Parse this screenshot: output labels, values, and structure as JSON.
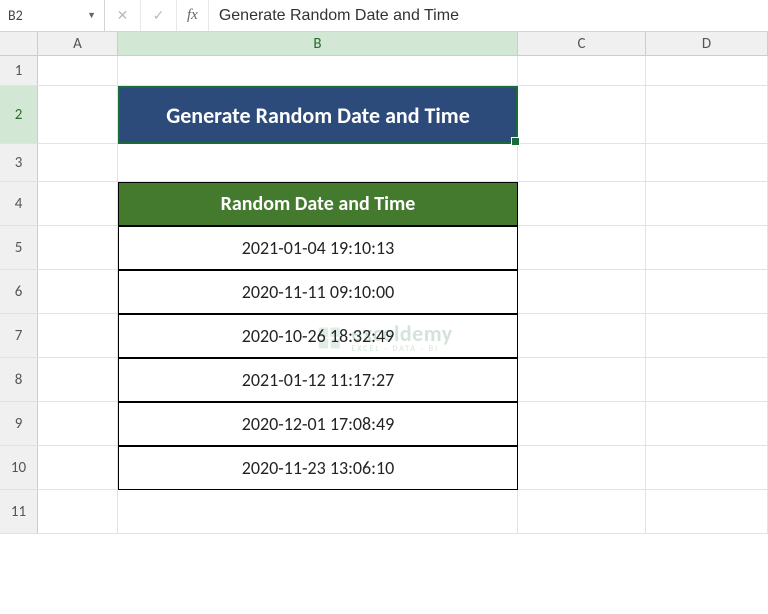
{
  "nameBox": "B2",
  "formulaBar": "Generate Random Date and Time",
  "columns": [
    "A",
    "B",
    "C",
    "D"
  ],
  "rows": [
    "1",
    "2",
    "3",
    "4",
    "5",
    "6",
    "7",
    "8",
    "9",
    "10",
    "11"
  ],
  "selectedCol": "B",
  "selectedRow": "2",
  "b2": "Generate Random Date and Time",
  "b4": "Random Date and Time",
  "data": {
    "b5": "2021-01-04 19:10:13",
    "b6": "2020-11-11 09:10:00",
    "b7": "2020-10-26 18:32:49",
    "b8": "2021-01-12 11:17:27",
    "b9": "2020-12-01 17:08:49",
    "b10": "2020-11-23 13:06:10"
  },
  "watermark": {
    "main": "exceldemy",
    "sub": "EXCEL · DATA · BI"
  }
}
